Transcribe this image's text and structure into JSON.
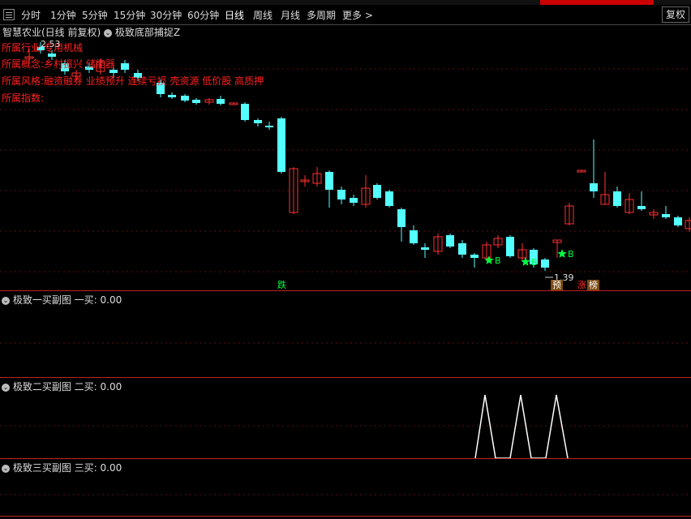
{
  "toolbar": {
    "periods": [
      "分时",
      "1分钟",
      "5分钟",
      "15分钟",
      "30分钟",
      "60分钟",
      "日线",
      "周线",
      "月线",
      "多周期",
      "更多 >"
    ],
    "active_period": "日线",
    "restore_label": "复权"
  },
  "header": {
    "stock_title": "智慧农业(日线 前复权)",
    "indicator_name": "极致底部捕捉Z"
  },
  "info": {
    "industry": "所属行业:专用机械",
    "concept": "所属概念:乡村振兴 储能器",
    "style": "所属风格:融资融券 业绩预升 连续亏损 壳资源 低价股 高质押",
    "index": "所属指数:",
    "high_price": "2.53"
  },
  "main_chart": {
    "low_label": "1.39",
    "buy_signal_text": "B",
    "markers": [
      "跌",
      "预",
      "涨",
      "榜"
    ]
  },
  "panels": [
    {
      "name": "极致一买副图",
      "label": "一买:",
      "value": "0.00"
    },
    {
      "name": "极致二买副图",
      "label": "二买:",
      "value": "0.00"
    },
    {
      "name": "极致三买副图",
      "label": "三买:",
      "value": "0.00"
    }
  ],
  "colors": {
    "up": "#ff3030",
    "down": "#54ffff",
    "signal": "#00ff40",
    "separator": "#c02020"
  }
}
